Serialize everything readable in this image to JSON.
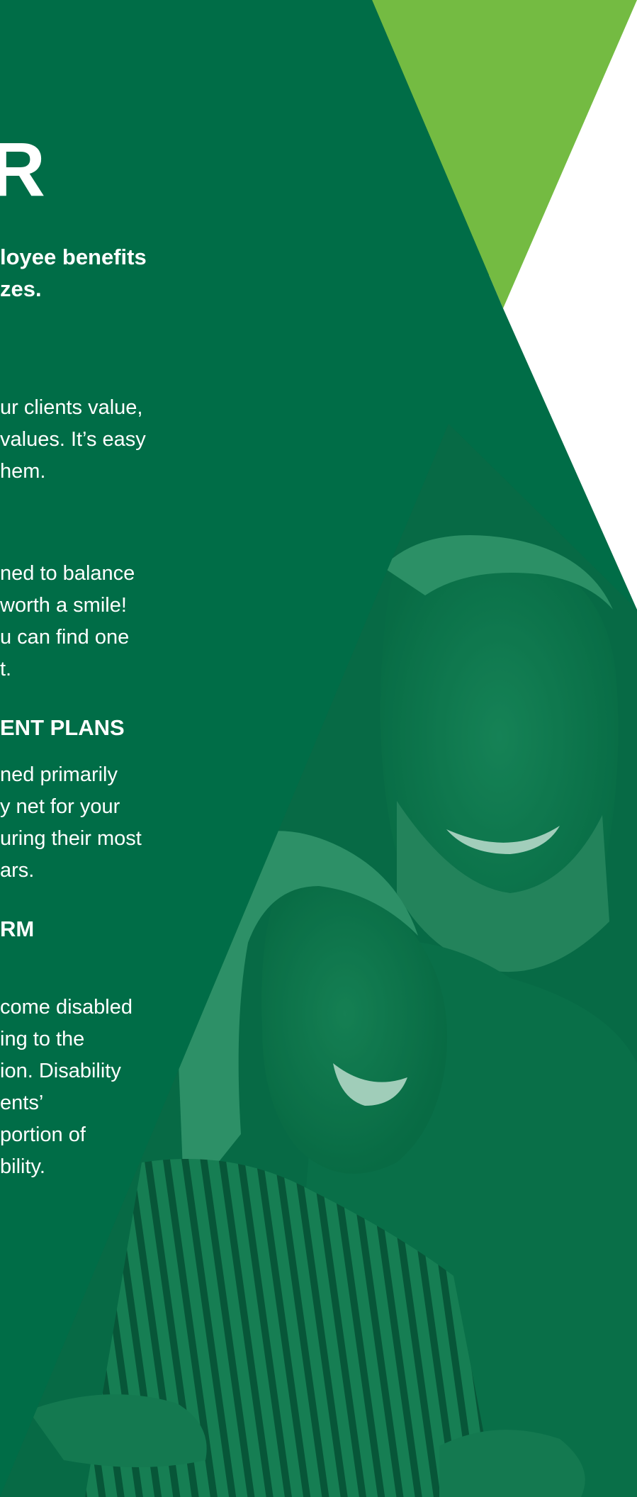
{
  "colors": {
    "background_green": "#006d47",
    "accent_green": "#74bb42",
    "white": "#ffffff",
    "text": "#ffffff"
  },
  "page": {
    "big_letter": "R",
    "intro": [
      "loyee benefits",
      "zes."
    ],
    "paragraph_1": [
      "ur clients value,",
      "values. It’s easy",
      "hem."
    ],
    "paragraph_2": [
      "ned to balance",
      "worth a smile!",
      "u can find one",
      "t."
    ],
    "heading_retirement": "ENT PLANS",
    "paragraph_3": [
      "ned primarily",
      "y net for your",
      "uring their most",
      "ars."
    ],
    "heading_term": "RM",
    "paragraph_4": [
      "come disabled",
      "ing to the",
      "ion. Disability",
      "ents’",
      "portion of",
      "bility."
    ]
  },
  "photo": {
    "subject": "smiling older couple embracing, green duotone"
  }
}
